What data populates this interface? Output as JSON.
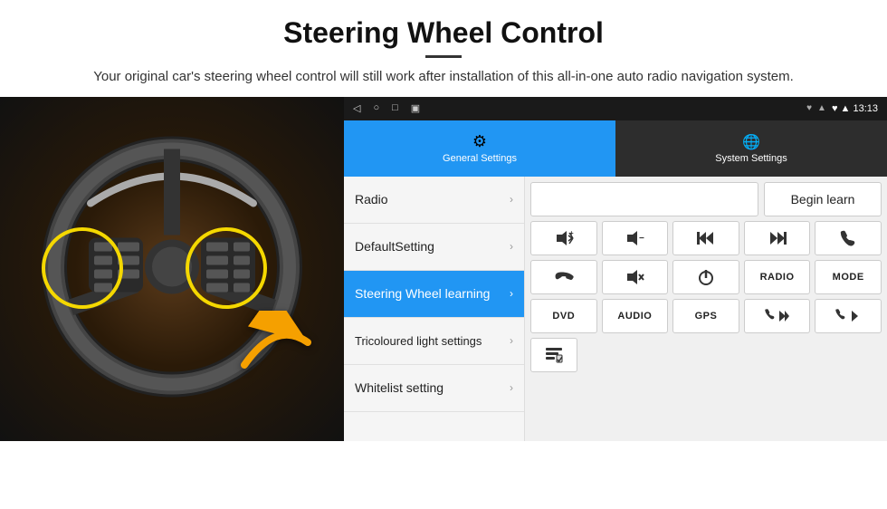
{
  "header": {
    "title": "Steering Wheel Control",
    "subtitle": "Your original car's steering wheel control will still work after installation of this all-in-one auto radio navigation system."
  },
  "status_bar": {
    "left_icons": [
      "◁",
      "○",
      "□",
      "▣"
    ],
    "right_info": "♥ ▲  13:13"
  },
  "tabs": [
    {
      "id": "general",
      "label": "General Settings",
      "icon": "⚙",
      "active": true
    },
    {
      "id": "system",
      "label": "System Settings",
      "icon": "🌐",
      "active": false
    }
  ],
  "menu": {
    "items": [
      {
        "label": "Radio",
        "active": false
      },
      {
        "label": "DefaultSetting",
        "active": false
      },
      {
        "label": "Steering Wheel learning",
        "active": true
      },
      {
        "label": "Tricoloured light settings",
        "active": false
      },
      {
        "label": "Whitelist setting",
        "active": false
      }
    ]
  },
  "controls": {
    "begin_learn_label": "Begin learn",
    "buttons_row1": [
      "🔊+",
      "🔊−",
      "⏮",
      "⏭",
      "📞"
    ],
    "buttons_row2": [
      "📞↩",
      "🔊✕",
      "⏻",
      "RADIO",
      "MODE"
    ],
    "buttons_row3": [
      "DVD",
      "AUDIO",
      "GPS",
      "📞⏮",
      "📞⏭"
    ],
    "whitelist_icon": "≡"
  }
}
